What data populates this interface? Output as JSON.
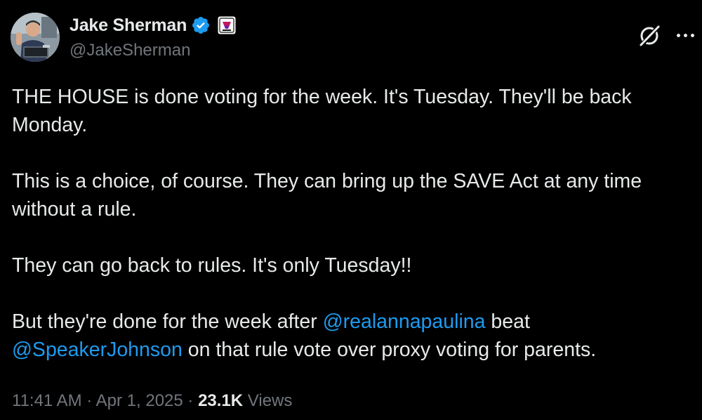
{
  "author": {
    "display_name": "Jake Sherman",
    "handle": "@JakeSherman",
    "verified": true,
    "verified_color": "#1d9bf0"
  },
  "tweet": {
    "paragraphs": [
      {
        "segments": [
          {
            "type": "text",
            "text": "THE HOUSE is done voting for the week. It's Tuesday. They'll be back Monday."
          }
        ]
      },
      {
        "segments": [
          {
            "type": "text",
            "text": "This is a choice, of course. They can bring up the SAVE Act at any time without a rule."
          }
        ]
      },
      {
        "segments": [
          {
            "type": "text",
            "text": "They can go back to rules. It's only Tuesday!!"
          }
        ]
      },
      {
        "segments": [
          {
            "type": "text",
            "text": "But they're done for the week after "
          },
          {
            "type": "mention",
            "text": "@realannapaulina"
          },
          {
            "type": "text",
            "text": " beat "
          },
          {
            "type": "mention",
            "text": "@SpeakerJohnson"
          },
          {
            "type": "text",
            "text": " on that rule vote over proxy voting for parents."
          }
        ]
      }
    ]
  },
  "meta": {
    "time": "11:41 AM",
    "separator": " · ",
    "date": "Apr 1, 2025",
    "views_count": "23.1K",
    "views_label": "Views"
  },
  "icons": {
    "grok": "grok-icon",
    "more": "more-icon",
    "verified": "verified-badge-icon",
    "affiliate": "affiliate-badge-icon"
  },
  "colors": {
    "background": "#000000",
    "text": "#e7e9ea",
    "secondary": "#71767b",
    "link": "#1d9bf0"
  }
}
